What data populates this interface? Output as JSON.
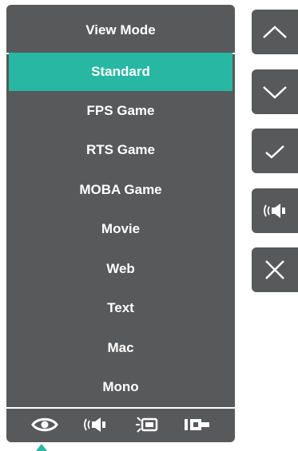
{
  "osd": {
    "title": "View Mode",
    "items": [
      {
        "label": "Standard",
        "selected": true
      },
      {
        "label": "FPS Game",
        "selected": false
      },
      {
        "label": "RTS Game",
        "selected": false
      },
      {
        "label": "MOBA Game",
        "selected": false
      },
      {
        "label": "Movie",
        "selected": false
      },
      {
        "label": "Web",
        "selected": false
      },
      {
        "label": "Text",
        "selected": false
      },
      {
        "label": "Mac",
        "selected": false
      },
      {
        "label": "Mono",
        "selected": false
      }
    ],
    "bottom_icons": [
      "eye-icon",
      "audio-icon",
      "brightness-icon",
      "input-icon"
    ],
    "active_bottom_icon": "eye-icon"
  },
  "side_buttons": [
    "up-arrow-icon",
    "down-arrow-icon",
    "check-icon",
    "audio-icon",
    "close-icon"
  ],
  "colors": {
    "panel": "#58595b",
    "accent": "#28b7a3",
    "text": "#ffffff"
  }
}
